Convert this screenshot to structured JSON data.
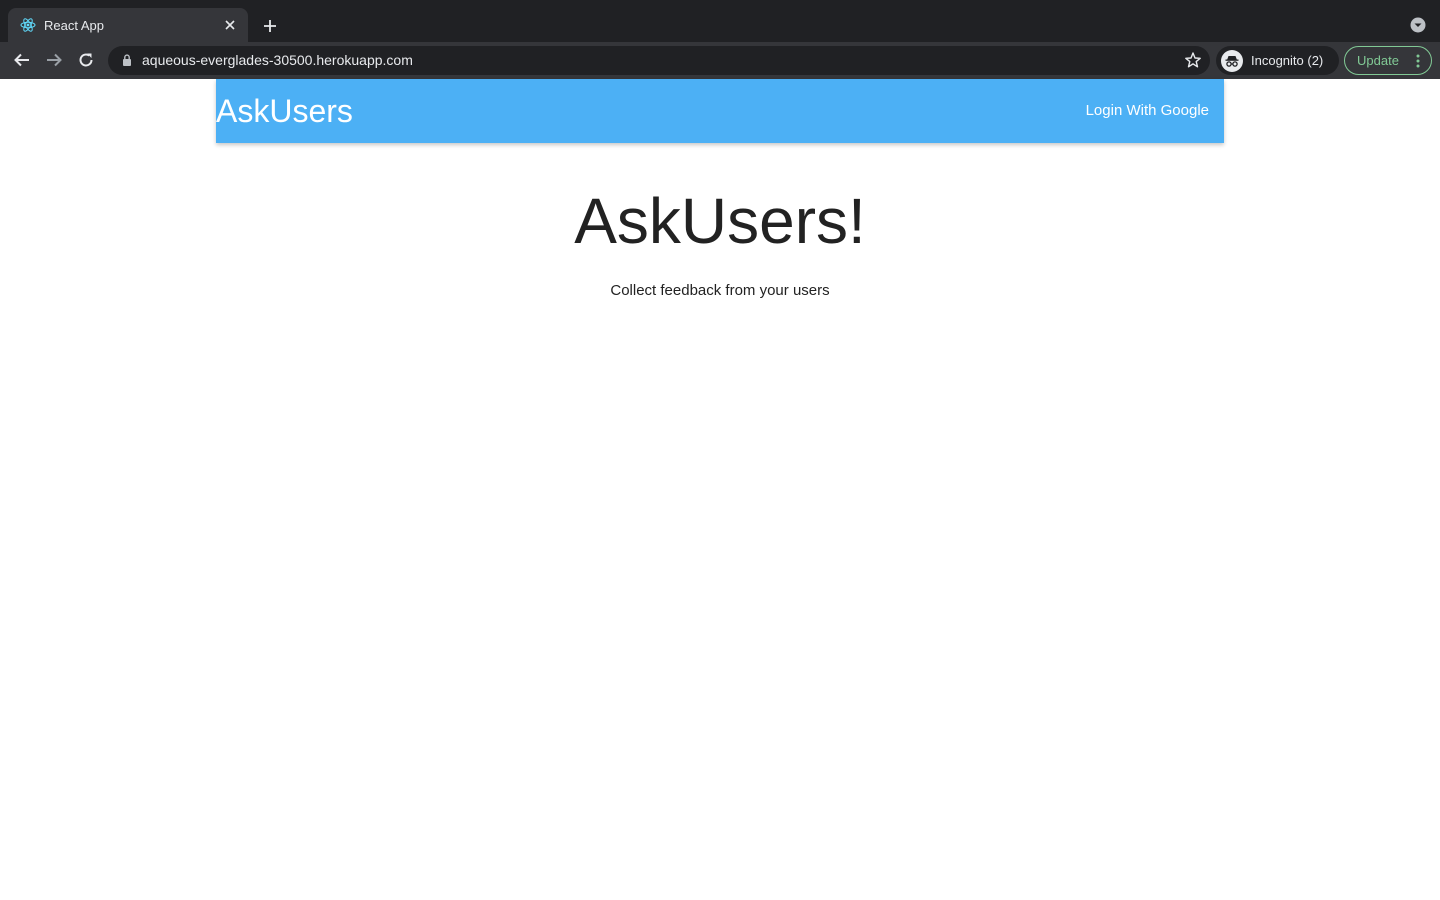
{
  "browser": {
    "tab": {
      "title": "React App",
      "favicon": "react-logo-icon"
    },
    "url": "aqueous-everglades-30500.herokuapp.com",
    "profile_label": "Incognito (2)",
    "update_label": "Update",
    "accent_update": "#81c995"
  },
  "app": {
    "brand": "AskUsers",
    "login_label": "Login With Google",
    "nav_color": "#4cb0f5",
    "hero_title": "AskUsers!",
    "hero_subtitle": "Collect feedback from your users"
  }
}
